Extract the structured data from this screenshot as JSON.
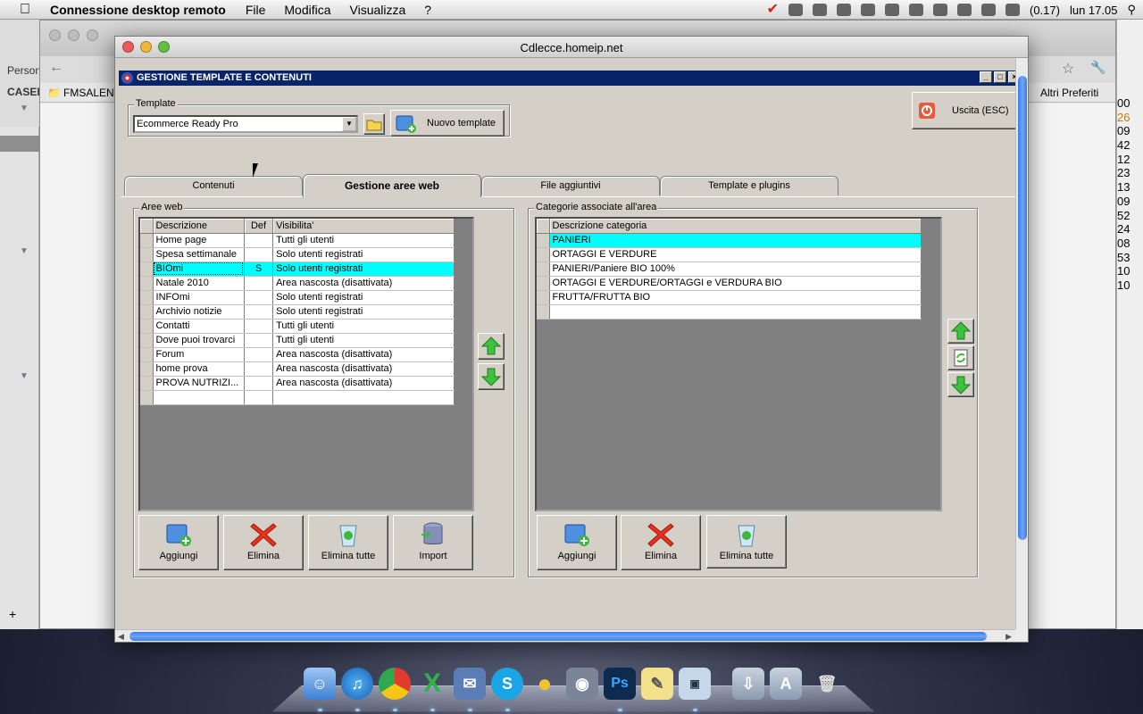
{
  "menubar": {
    "app_name": "Connessione desktop remoto",
    "menus": [
      "File",
      "Modifica",
      "Visualizza",
      "?"
    ],
    "battery": "(0.17)",
    "clock": "lun 17.05"
  },
  "browser": {
    "person_label": "Person",
    "bookmark_left": "CASEL",
    "bookmark_folder": "FMSALENT",
    "bookmark_right": "Altri Preferiti",
    "side_numbers": [
      "00",
      "26",
      "09",
      "42",
      "12",
      "23",
      "13",
      "09",
      "52",
      "24",
      "08",
      "53",
      "10",
      "10"
    ]
  },
  "rdp_window": {
    "title": "Cdlecce.homeip.net"
  },
  "app": {
    "title": "GESTIONE TEMPLATE E CONTENUTI",
    "template_group_label": "Template",
    "template_selected": "Ecommerce Ready Pro",
    "new_template_label": "Nuovo template",
    "exit_label": "Uscita (ESC)",
    "tabs": [
      {
        "label": "Contenuti"
      },
      {
        "label": "Gestione aree web"
      },
      {
        "label": "File aggiuntivi"
      },
      {
        "label": "Template e plugins"
      }
    ],
    "areas_group_label": "Aree web",
    "areas_columns": {
      "desc": "Descrizione",
      "def": "Def",
      "vis": "Visibilita'"
    },
    "areas": [
      {
        "desc": "Home page",
        "def": "",
        "vis": "Tutti gli utenti"
      },
      {
        "desc": "Spesa settimanale",
        "def": "",
        "vis": "Solo utenti registrati"
      },
      {
        "desc": "BIOmi",
        "def": "S",
        "vis": "Solo utenti registrati"
      },
      {
        "desc": "Natale 2010",
        "def": "",
        "vis": "Area nascosta (disattivata)"
      },
      {
        "desc": "INFOmi",
        "def": "",
        "vis": "Solo utenti registrati"
      },
      {
        "desc": "Archivio notizie",
        "def": "",
        "vis": "Solo utenti registrati"
      },
      {
        "desc": "Contatti",
        "def": "",
        "vis": "Tutti gli utenti"
      },
      {
        "desc": "Dove puoi trovarci",
        "def": "",
        "vis": "Tutti gli utenti"
      },
      {
        "desc": "Forum",
        "def": "",
        "vis": "Area nascosta (disattivata)"
      },
      {
        "desc": "home prova",
        "def": "",
        "vis": "Area nascosta (disattivata)"
      },
      {
        "desc": "PROVA NUTRIZI...",
        "def": "",
        "vis": "Area nascosta (disattivata)"
      }
    ],
    "categories_group_label": "Categorie associate all'area",
    "categories_column": "Descrizione categoria",
    "categories": [
      "PANIERI",
      "ORTAGGI E VERDURE",
      "PANIERI/Paniere BIO 100%",
      "ORTAGGI E VERDURE/ORTAGGI e VERDURA BIO",
      "FRUTTA/FRUTTA BIO"
    ],
    "area_buttons": {
      "add": "Aggiungi",
      "delete": "Elimina",
      "delete_all": "Elimina tutte",
      "import": "Import"
    },
    "category_buttons": {
      "add": "Aggiungi",
      "delete": "Elimina",
      "delete_all": "Elimina tutte"
    }
  },
  "colors": {
    "selection": "#00ffff",
    "win_title": "#0a246a",
    "win_face": "#d4d0c8"
  }
}
